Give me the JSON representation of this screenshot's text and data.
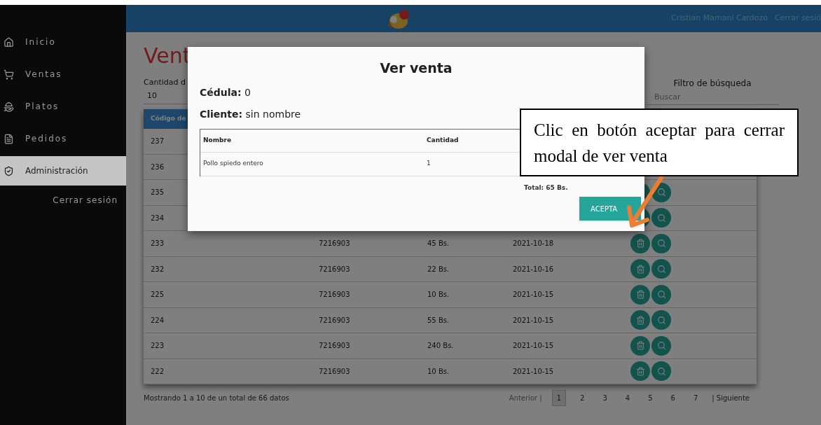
{
  "header": {
    "user": "Cristian Mamani Cardozo",
    "logout": "Cerrar sesió"
  },
  "sidebar": {
    "items": [
      {
        "label": "Inicio",
        "selected": false
      },
      {
        "label": "Ventas",
        "selected": false
      },
      {
        "label": "Platos",
        "selected": false
      },
      {
        "label": "Pedidos",
        "selected": false
      },
      {
        "label": "Administración",
        "selected": true
      }
    ],
    "logout": "Cerrar sesión"
  },
  "page": {
    "title": "Vent",
    "page_size_label": "Cantidad d",
    "page_size": "10",
    "filter_label": "Filtro de búsqueda",
    "search": {
      "placeholder": "Buscar"
    }
  },
  "table": {
    "columns": [
      "Código de"
    ],
    "rows": [
      {
        "code": "237"
      },
      {
        "code": "236"
      },
      {
        "code": "235"
      },
      {
        "code": "234"
      },
      {
        "code": "233",
        "client": "7216903",
        "total": "45 Bs.",
        "date": "2021-10-18"
      },
      {
        "code": "232",
        "client": "7216903",
        "total": "22 Bs.",
        "date": "2021-10-16"
      },
      {
        "code": "225",
        "client": "7216903",
        "total": "10 Bs.",
        "date": "2021-10-15"
      },
      {
        "code": "224",
        "client": "7216903",
        "total": "55 Bs.",
        "date": "2021-10-15"
      },
      {
        "code": "223",
        "client": "7216903",
        "total": "240 Bs.",
        "date": "2021-10-15"
      },
      {
        "code": "222",
        "client": "7216903",
        "total": "10 Bs.",
        "date": "2021-10-15"
      }
    ]
  },
  "footer": {
    "summary": "Mostrando 1 a 10 de un total de 66 datos",
    "previous": "Anterior |",
    "next": "| Siguiente",
    "pages": [
      {
        "label": "1",
        "selected": true
      },
      {
        "label": "2",
        "selected": false
      },
      {
        "label": "3",
        "selected": false
      },
      {
        "label": "4",
        "selected": false
      },
      {
        "label": "5",
        "selected": false
      },
      {
        "label": "6",
        "selected": false
      },
      {
        "label": "7",
        "selected": false
      }
    ]
  },
  "modal": {
    "title": "Ver venta",
    "id_label": "Cédula:",
    "id_value": "0",
    "client_label": "Cliente:",
    "client_value": "sin nombre",
    "columns": [
      "Nombre",
      "Cantidad"
    ],
    "rows": [
      [
        "Pollo spiedo entero",
        "1"
      ]
    ],
    "total": "Total: 65 Bs.",
    "button": "ACEPTA"
  },
  "annotation": {
    "text": "Clic en botón aceptar para cerrar modal de ver venta"
  }
}
